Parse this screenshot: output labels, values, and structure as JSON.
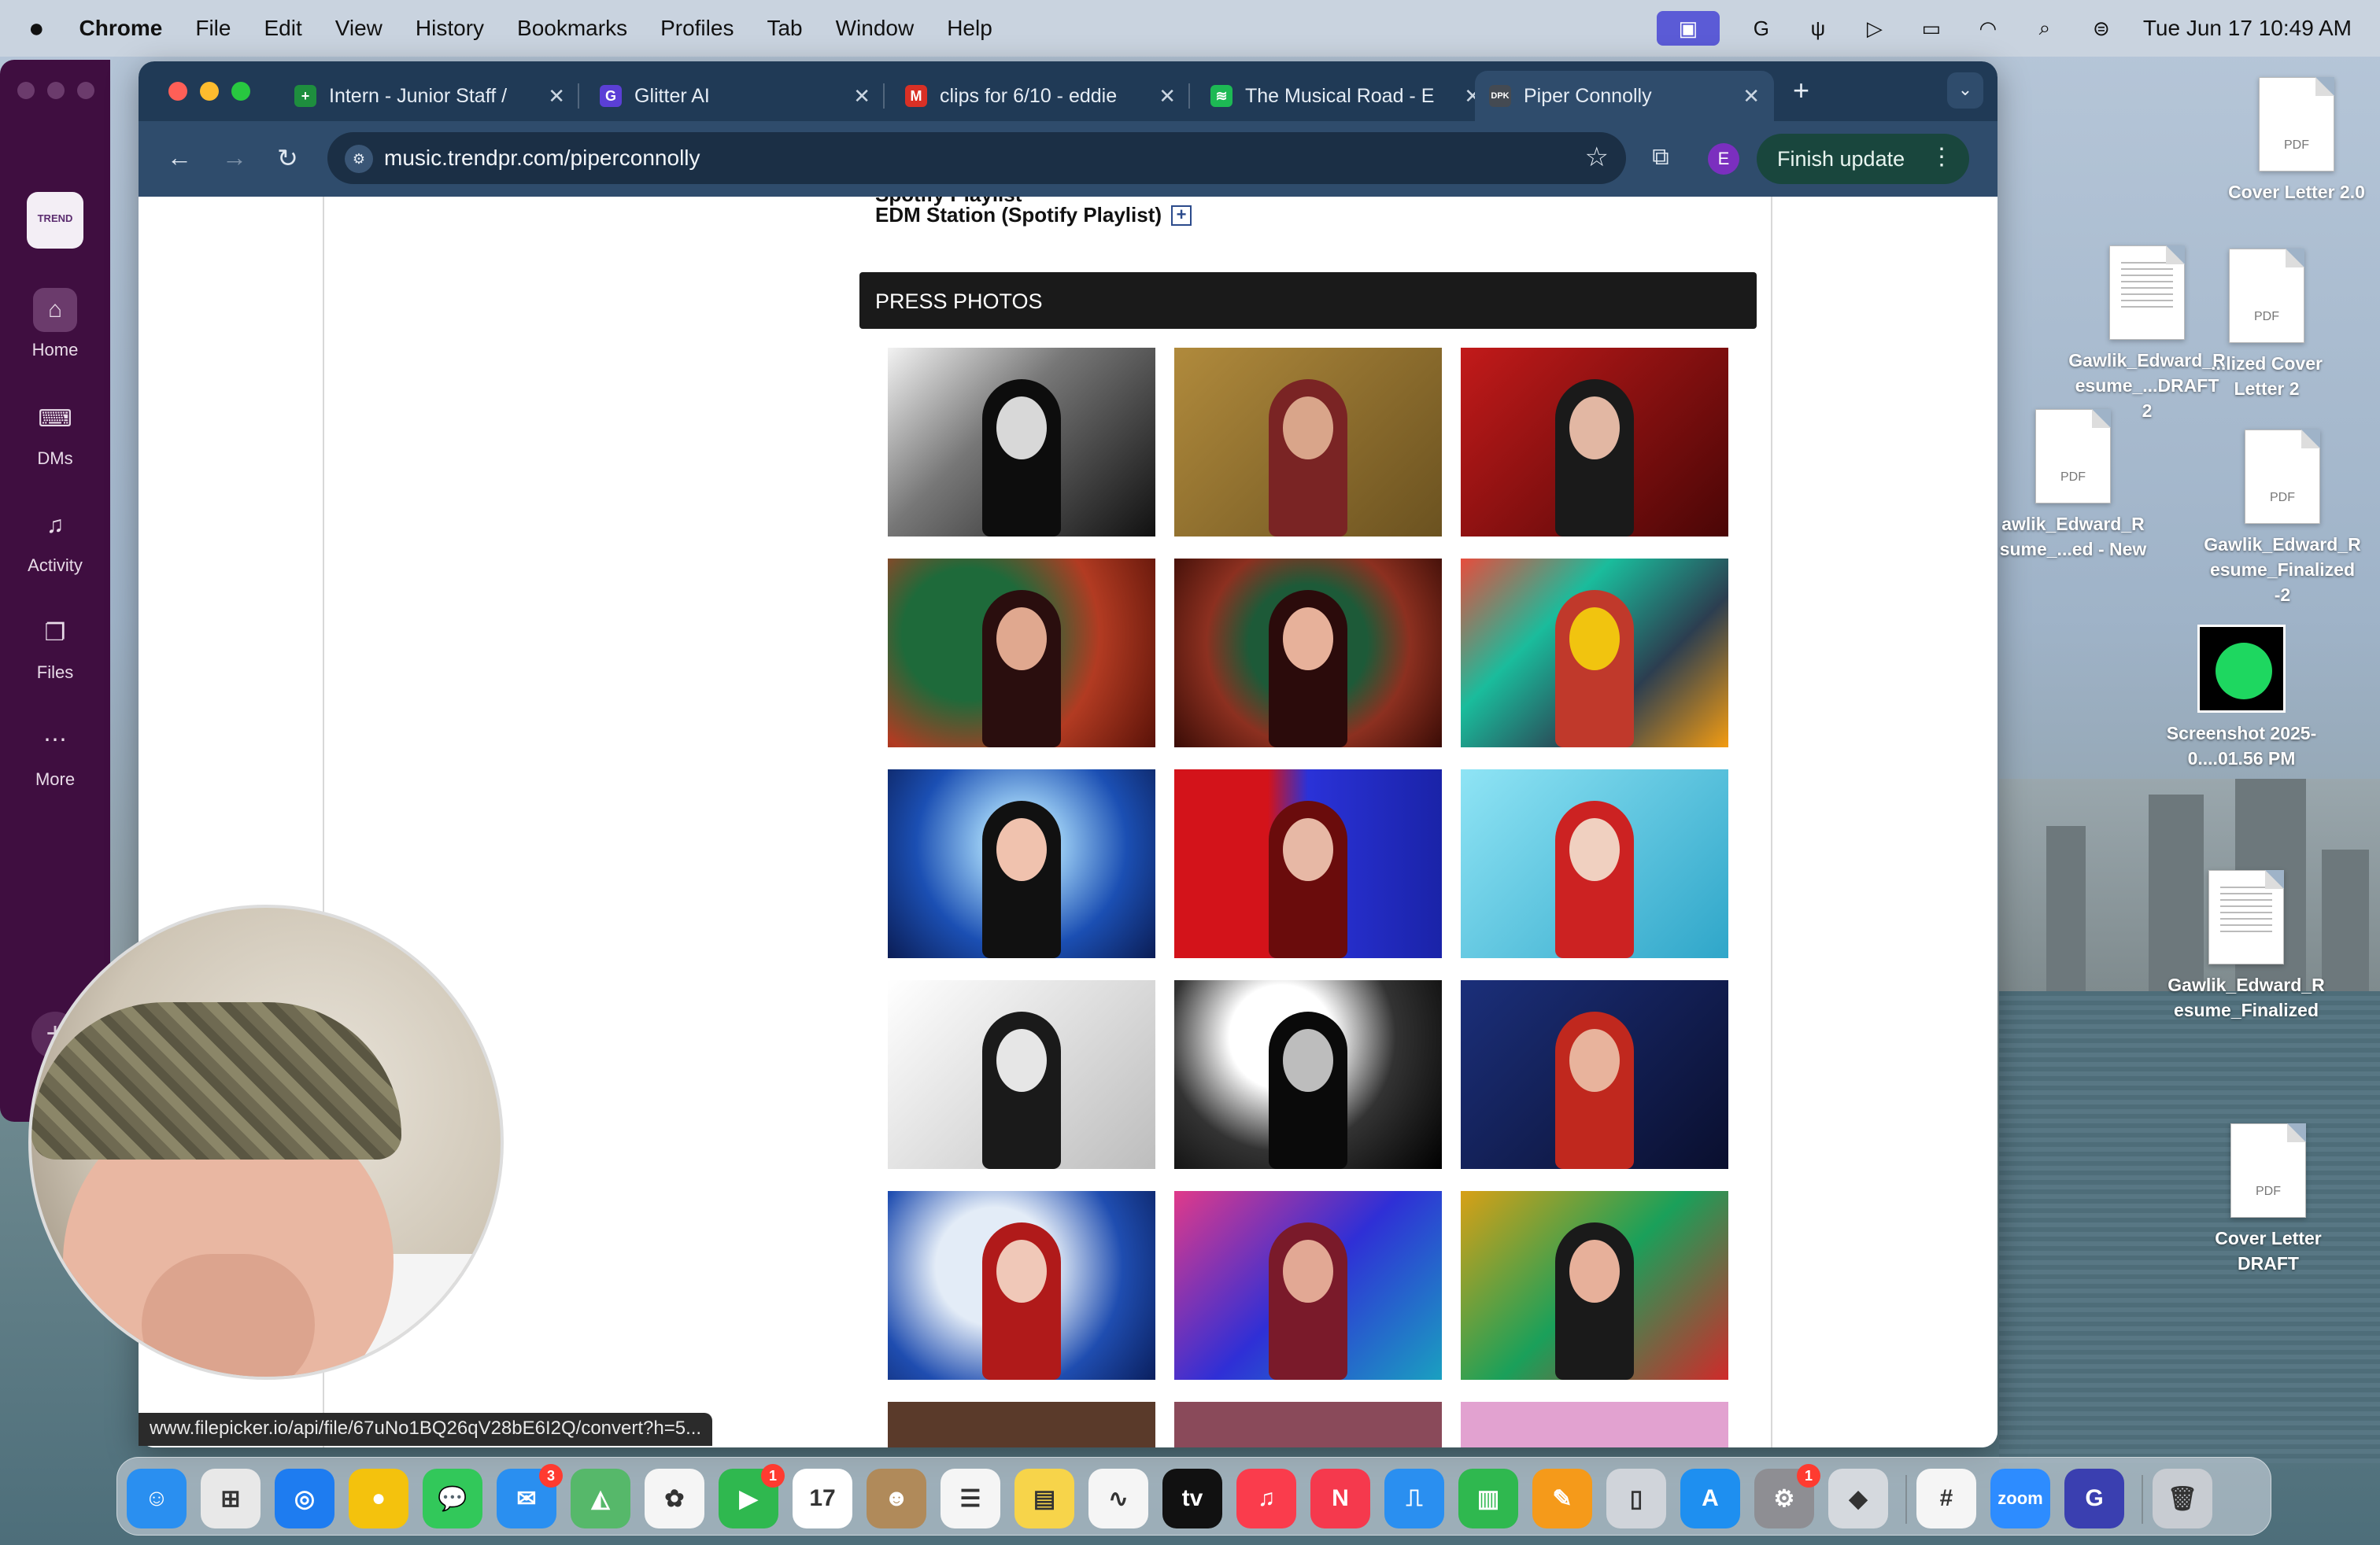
{
  "menubar": {
    "apple_icon": "apple-icon",
    "app_name": "Chrome",
    "menus": [
      "File",
      "Edit",
      "View",
      "History",
      "Bookmarks",
      "Profiles",
      "Tab",
      "Window",
      "Help"
    ],
    "clock": "Tue Jun 17  10:49 AM"
  },
  "slack": {
    "logo_text": "TREND",
    "nav": [
      {
        "label": "Home",
        "icon": "home-icon"
      },
      {
        "label": "DMs",
        "icon": "chat-bubbles-icon"
      },
      {
        "label": "Activity",
        "icon": "bell-icon"
      },
      {
        "label": "Files",
        "icon": "files-icon"
      },
      {
        "label": "More",
        "icon": "ellipsis-icon"
      }
    ],
    "add_label": "+"
  },
  "browser": {
    "tabs": [
      {
        "title": "Intern - Junior Staff / ",
        "icon": "sheets-icon",
        "fav_color": "#1e8e3e",
        "fav_text": "+"
      },
      {
        "title": "Glitter AI",
        "icon": "glitter-icon",
        "fav_color": "#5b3fd6",
        "fav_text": "G"
      },
      {
        "title": "clips for 6/10 - eddie",
        "icon": "gmail-icon",
        "fav_color": "#d93025",
        "fav_text": "M"
      },
      {
        "title": "The Musical Road - E",
        "icon": "spotify-icon",
        "fav_color": "#1db954",
        "fav_text": "≋"
      },
      {
        "title": "Piper Connolly",
        "icon": "dpk-icon",
        "fav_color": "#444a52",
        "fav_text": "DPK"
      }
    ],
    "new_tab": "+",
    "url": "music.trendpr.com/piperconnolly",
    "profile_initial": "E",
    "finish_update": "Finish update"
  },
  "page": {
    "cut_text": "Spotify Playlist",
    "edm_link": "EDM Station (Spotify Playlist)",
    "press_header": "PRESS PHOTOS",
    "photos": [
      {
        "bg": "#2a2a2a",
        "fig": "#0d0d0d",
        "face": "#d8d8d8",
        "tone": "linear-gradient(135deg,#f2f2f2 0%,#777 40%,#111 100%)"
      },
      {
        "bg": "#8a6a2a",
        "fig": "#7a2424",
        "face": "#d9a58a",
        "tone": "linear-gradient(135deg,#b08a3c,#6b5220)"
      },
      {
        "bg": "#8f1010",
        "fig": "#1a1a1a",
        "face": "#e2b7a3",
        "tone": "linear-gradient(135deg,#c21a1a,#4a0606)"
      },
      {
        "bg": "#9b2e1e",
        "fig": "#2a0e0e",
        "face": "#e0a88f",
        "tone": "radial-gradient(circle at 30% 40%,#1e6a3a 0 30%,#b23b22 60%,#5a1208)"
      },
      {
        "bg": "#4a1a12",
        "fig": "#2b0b0b",
        "face": "#e7b19a",
        "tone": "radial-gradient(circle at 50% 45%,#1d5a38 0 35%,#8c3020 60%,#3a0c06)"
      },
      {
        "bg": "#1a2a6a",
        "fig": "#c0392b",
        "face": "#f1c40f",
        "tone": "linear-gradient(135deg,#e74c3c,#1abc9c,#2c3e50,#f39c12)"
      },
      {
        "bg": "#1f4fb0",
        "fig": "#111",
        "face": "#f0c2ae",
        "tone": "radial-gradient(circle at 50% 40%,#9ed0f5 0 20%,#1b4fb3 60%,#0b1d55)"
      },
      {
        "bg": "#1a2ad0",
        "fig": "#6a0c0c",
        "face": "#e7b8a5",
        "tone": "linear-gradient(90deg,#d3131a 0 35%,#2a32d8 50%,#1a23a8)"
      },
      {
        "bg": "#5fc7e0",
        "fig": "#c22",
        "face": "#f0d0c0",
        "tone": "linear-gradient(135deg,#8fe4f5,#2fa6c9)"
      },
      {
        "bg": "#f4f4f4",
        "fig": "#1a1a1a",
        "face": "#e6e6e6",
        "tone": "linear-gradient(135deg,#ffffff,#bdbdbd)"
      },
      {
        "bg": "#111",
        "fig": "#0a0a0a",
        "face": "#bdbdbd",
        "tone": "radial-gradient(circle at 40% 30%,#ffffff 0 25%,#333 55%,#000)"
      },
      {
        "bg": "#0d1a44",
        "fig": "#c0281e",
        "face": "#e8b39c",
        "tone": "linear-gradient(135deg,#1b2f7a,#0a0f2e)"
      },
      {
        "bg": "#163b9a",
        "fig": "#b01a1a",
        "face": "#f0c8b8",
        "tone": "radial-gradient(circle at 40% 40%,#e3ecf7 0 30%,#1f4db0 65%,#0a1f5e)"
      },
      {
        "bg": "#2a1a7a",
        "fig": "#7a1a2a",
        "face": "#e2a894",
        "tone": "linear-gradient(135deg,#e03a8a,#2f2fd6,#1aa0c0)"
      },
      {
        "bg": "#1b5a2a",
        "fig": "#1a1a1a",
        "face": "#e7b09a",
        "tone": "linear-gradient(135deg,#d8a016,#1aa05a,#d02a2a)"
      }
    ]
  },
  "status_url": "www.filepicker.io/api/file/67uNo1BQ26qV28bE6I2Q/convert?h=5...",
  "desktop": [
    {
      "label": "Cover Letter 2.0",
      "kind": "pdf"
    },
    {
      "label": "Gawlik_Edward_R esume_...DRAFT 2",
      "kind": "doc"
    },
    {
      "label": "...lized Cover Letter 2",
      "kind": "pdf"
    },
    {
      "label": "awlik_Edward_R sume_...ed - New",
      "kind": "pdf"
    },
    {
      "label": "Gawlik_Edward_R esume_Finalized -2",
      "kind": "pdf"
    },
    {
      "label": "Screenshot 2025-0....01.56 PM",
      "kind": "spotify"
    },
    {
      "label": "Gawlik_Edward_R esume_Finalized",
      "kind": "doc"
    },
    {
      "label": "Cover Letter DRAFT",
      "kind": "pdf"
    }
  ],
  "dock": [
    {
      "name": "finder",
      "color": "#2a8ff0",
      "glyph": "☺"
    },
    {
      "name": "launchpad",
      "color": "#e8e8e8",
      "glyph": "⊞"
    },
    {
      "name": "safari",
      "color": "#1e7cf0",
      "glyph": "◎"
    },
    {
      "name": "chrome",
      "color": "#f4c20d",
      "glyph": "●"
    },
    {
      "name": "messages",
      "color": "#32c85a",
      "glyph": "💬"
    },
    {
      "name": "mail",
      "color": "#2a8ff0",
      "glyph": "✉",
      "badge": "3"
    },
    {
      "name": "maps",
      "color": "#56b86a",
      "glyph": "◭"
    },
    {
      "name": "photos",
      "color": "#f5f5f5",
      "glyph": "✿"
    },
    {
      "name": "facetime",
      "color": "#2fb84f",
      "glyph": "▶",
      "badge": "1"
    },
    {
      "name": "calendar",
      "color": "#ffffff",
      "glyph": "17"
    },
    {
      "name": "contacts",
      "color": "#b08a5a",
      "glyph": "☻"
    },
    {
      "name": "reminders",
      "color": "#f5f5f5",
      "glyph": "☰"
    },
    {
      "name": "notes",
      "color": "#f7d44a",
      "glyph": "▤"
    },
    {
      "name": "freeform",
      "color": "#f5f5f5",
      "glyph": "∿"
    },
    {
      "name": "tv",
      "color": "#111",
      "glyph": "tv"
    },
    {
      "name": "music",
      "color": "#fa3c4c",
      "glyph": "♫"
    },
    {
      "name": "news",
      "color": "#f5394d",
      "glyph": "N"
    },
    {
      "name": "keynote",
      "color": "#2a8ff0",
      "glyph": "⎍"
    },
    {
      "name": "numbers",
      "color": "#2fb84f",
      "glyph": "▥"
    },
    {
      "name": "pages",
      "color": "#f59a1a",
      "glyph": "✎"
    },
    {
      "name": "iphone-mirroring",
      "color": "#d0d4da",
      "glyph": "▯"
    },
    {
      "name": "app-store",
      "color": "#1e8ff0",
      "glyph": "A"
    },
    {
      "name": "system-settings",
      "color": "#8e8e93",
      "glyph": "⚙",
      "badge": "1"
    },
    {
      "name": "roblox",
      "color": "#d5d9de",
      "glyph": "◆"
    },
    {
      "name": "slack",
      "color": "#f5f5f5",
      "glyph": "#"
    },
    {
      "name": "zoom",
      "color": "#2d8cff",
      "glyph": "zoom"
    },
    {
      "name": "glitter",
      "color": "#3a3fb0",
      "glyph": "G"
    },
    {
      "name": "trash",
      "color": "#c8ccd2",
      "glyph": "🗑"
    }
  ]
}
